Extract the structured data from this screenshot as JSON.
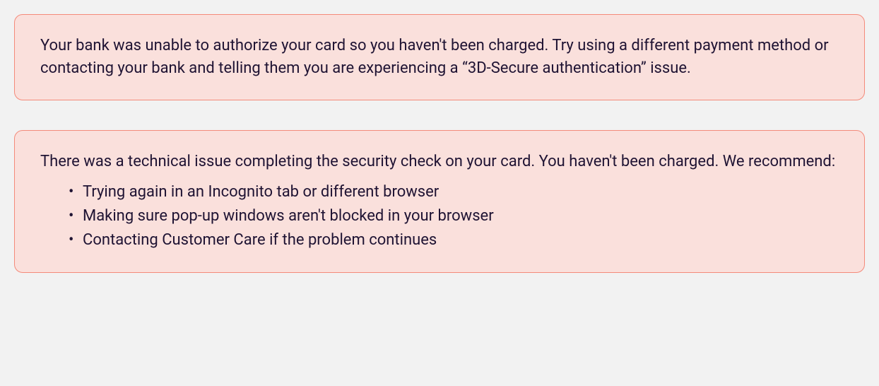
{
  "alerts": [
    {
      "text": "Your bank was unable to authorize your card so you haven't been charged. Try using a different payment method or contacting your bank and telling them you are experiencing a “3D-Secure authentication” issue."
    },
    {
      "text": "There was a technical issue completing the security check on your card. You haven't been charged. We recommend:",
      "items": [
        "Trying again in an Incognito tab or different browser",
        "Making sure pop-up windows aren't blocked in your browser",
        "Contacting Customer Care if the problem continues"
      ]
    }
  ]
}
